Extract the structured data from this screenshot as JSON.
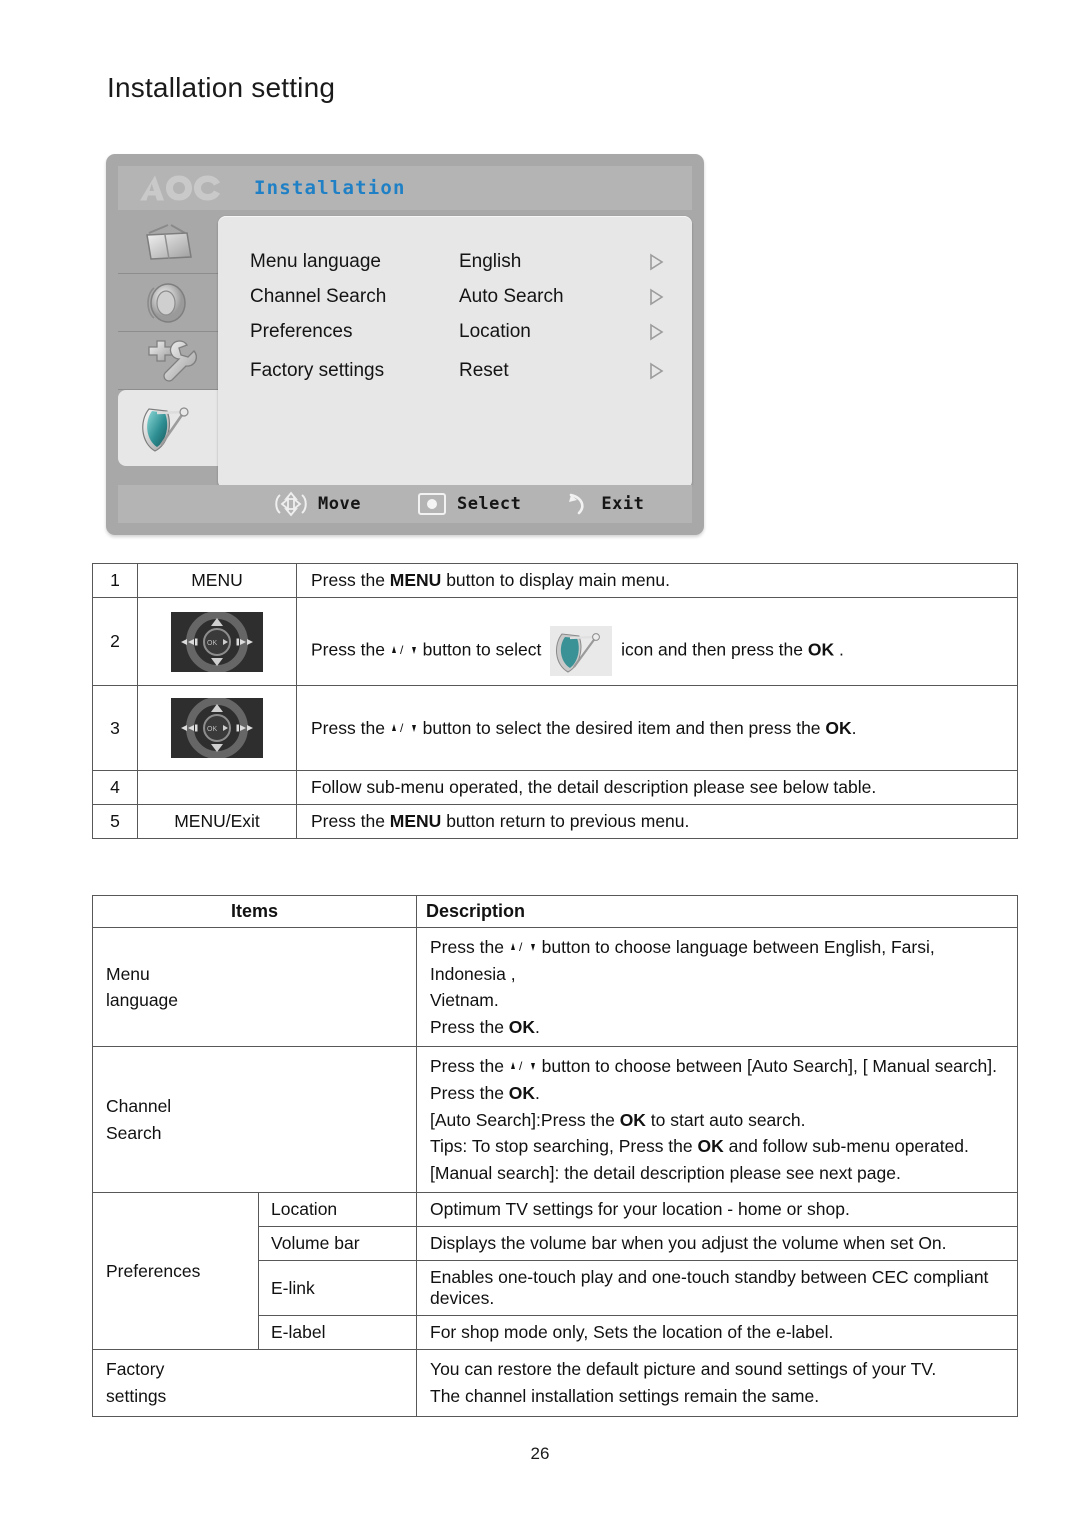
{
  "page": {
    "title": "Installation setting",
    "number": "26"
  },
  "osd": {
    "brand": "AOC",
    "title": "Installation",
    "rail": [
      {
        "name": "picture-tv-icon"
      },
      {
        "name": "sound-speaker-icon"
      },
      {
        "name": "function-wrench-icon"
      },
      {
        "name": "installation-dish-icon",
        "selected": true
      }
    ],
    "rows": [
      {
        "label": "Menu language",
        "value": "English",
        "arrow": "chevron-right-icon"
      },
      {
        "label": "Channel Search",
        "value": "Auto Search",
        "arrow": "chevron-right-icon"
      },
      {
        "label": "Preferences",
        "value": "Location",
        "arrow": "chevron-right-icon"
      },
      {
        "label": "Factory settings",
        "value": "Reset",
        "arrow": "chevron-right-icon"
      }
    ],
    "hints": {
      "move": "Move",
      "select": "Select",
      "exit": "Exit"
    }
  },
  "steps_table": {
    "rows": [
      {
        "num": "1",
        "key": "MENU",
        "desc_pre": "Press the ",
        "desc_bold": "MENU",
        "desc_post": " button to display main menu."
      },
      {
        "num": "2",
        "key": "",
        "key_icon": "dpad-navigation-button",
        "desc_a": "Press the ",
        "desc_b": " button to select ",
        "desc_icon": "installation-dish-icon",
        "desc_c": " icon and then press the ",
        "desc_bold": "OK",
        "desc_d": " ."
      },
      {
        "num": "3",
        "key": "",
        "key_icon": "dpad-navigation-button",
        "desc_a": "Press the ",
        "desc_b": " button to select the desired item and then press the ",
        "desc_bold": "OK",
        "desc_c": "."
      },
      {
        "num": "4",
        "key": "",
        "desc_plain": "Follow sub-menu operated, the detail description please see below table."
      },
      {
        "num": "5",
        "key": "MENU/Exit",
        "desc_pre": "Press the ",
        "desc_bold": "MENU",
        "desc_post": " button return to previous menu."
      }
    ]
  },
  "items_table": {
    "headers": {
      "items": "Items",
      "description": "Description"
    },
    "menu_language": {
      "item": "Menu language",
      "item_l1": "Menu",
      "item_l2": "language",
      "line1_a": "Press the ",
      "line1_b": " button to choose language between English, Farsi, Indonesia ,",
      "line2": "Vietnam.",
      "line3_pre": "Press the ",
      "line3_bold": "OK",
      "line3_post": "."
    },
    "channel_search": {
      "item_l1": "Channel",
      "item_l2": "Search",
      "line1_a": "Press the ",
      "line1_b": " button to choose between [Auto Search], [ Manual search].",
      "line2_pre": "Press the ",
      "line2_bold": "OK",
      "line2_post": ".",
      "line3_pre": "[Auto Search]:Press the ",
      "line3_bold": "OK",
      "line3_post": " to start auto search.",
      "line4_pre": "Tips: To stop searching, Press the ",
      "line4_bold": "OK",
      "line4_post": " and follow sub-menu operated.",
      "line5": "[Manual search]: the detail description please see next page."
    },
    "preferences": {
      "item": "Preferences",
      "subrows": [
        {
          "name": "Location",
          "desc": "Optimum TV settings for your location - home or shop."
        },
        {
          "name": "Volume bar",
          "desc": "Displays the volume bar when you adjust the volume when set On."
        },
        {
          "name": "E-link",
          "desc": "Enables one-touch play and one-touch standby between CEC compliant devices."
        },
        {
          "name": "E-label",
          "desc": "For shop mode only, Sets the location of the e-label."
        }
      ]
    },
    "factory_settings": {
      "item_l1": "Factory",
      "item_l2": "settings",
      "line1": "You can restore the default picture and sound settings of your TV.",
      "line2": "The channel installation settings remain the same."
    }
  },
  "colors": {
    "osd_body": "#a8a8a8",
    "osd_bar": "#b4b4b4",
    "osd_panel": "#e7e7e7",
    "osd_title": "#1f80c6",
    "dish_teal": "#2e8f93",
    "table_border": "#585858"
  }
}
